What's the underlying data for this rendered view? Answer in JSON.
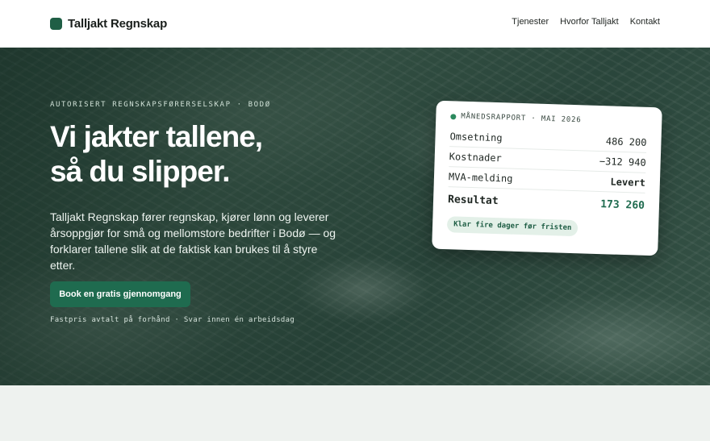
{
  "header": {
    "brand": "Talljakt Regnskap",
    "nav": [
      "Tjenester",
      "Hvorfor Talljakt",
      "Kontakt"
    ]
  },
  "hero": {
    "eyebrow": "AUTORISERT REGNSKAPSFØRERSELSKAP · BODØ",
    "headline_line1": "Vi jakter tallene,",
    "headline_line2": "så du slipper.",
    "lede": "Talljakt Regnskap fører regnskap, kjører lønn og leverer årsoppgjør for små og mellomstore bedrifter i Bodø — og forklarer tallene slik at de faktisk kan brukes til å styre etter.",
    "cta_label": "Book en gratis gjennomgang",
    "cta_note": "Fastpris avtalt på forhånd · Svar innen én arbeidsdag"
  },
  "report": {
    "title": "MÅNEDSRAPPORT · MAI 2026",
    "rows": [
      {
        "label": "Omsetning",
        "value": "486 200"
      },
      {
        "label": "Kostnader",
        "value": "−312 940"
      },
      {
        "label": "MVA-melding",
        "value": "Levert"
      }
    ],
    "result_label": "Resultat",
    "result_value": "173 260",
    "pill": "Klar fire dager før fristen"
  },
  "colors": {
    "brand_green": "#1f6b4f",
    "logo_green": "#1f5e45"
  }
}
